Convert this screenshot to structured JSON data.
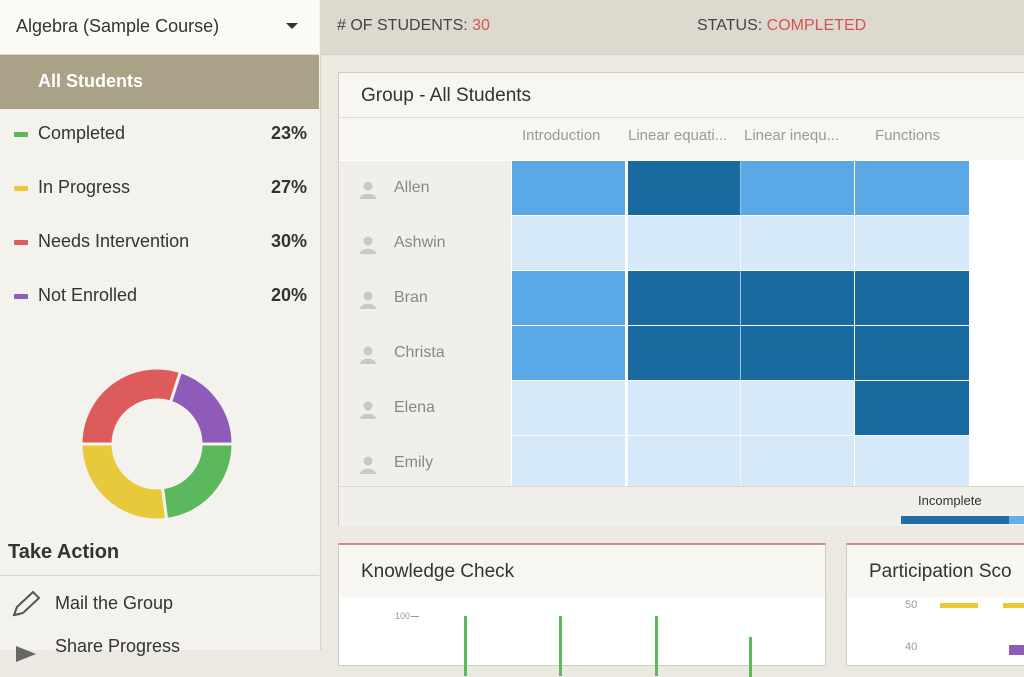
{
  "course_select": {
    "label": "Algebra (Sample Course)"
  },
  "topbar": {
    "students_label": "# OF STUDENTS:",
    "students_value": "30",
    "status_label": "STATUS:",
    "status_value": "COMPLETED"
  },
  "sidebar": {
    "all_students": "All Students",
    "legend": [
      {
        "name": "Completed",
        "pct": "23%",
        "color": "#5cb85c"
      },
      {
        "name": "In Progress",
        "pct": "27%",
        "color": "#e8c93a"
      },
      {
        "name": "Needs Intervention",
        "pct": "30%",
        "color": "#dd5b5b"
      },
      {
        "name": "Not Enrolled",
        "pct": "20%",
        "color": "#8e5bb8"
      }
    ],
    "take_action": "Take Action",
    "actions": [
      {
        "label": "Mail the Group",
        "icon": "pencil-icon"
      },
      {
        "label": "Share Progress",
        "icon": "share-icon"
      }
    ]
  },
  "group": {
    "title": "Group - All Students",
    "columns": [
      "Introduction",
      "Linear equati...",
      "Linear inequ...",
      "Functions"
    ],
    "students": [
      "Allen",
      "Ashwin",
      "Bran",
      "Christa",
      "Elena",
      "Emily"
    ],
    "legend_label": "Incomplete"
  },
  "knowledge_check": {
    "title": "Knowledge Check",
    "tick": "100"
  },
  "participation": {
    "title": "Participation Sco",
    "ticks": [
      "50",
      "40"
    ]
  },
  "chart_data": [
    {
      "type": "pie",
      "labels": [
        "Completed",
        "In Progress",
        "Needs Intervention",
        "Not Enrolled"
      ],
      "values": [
        23,
        27,
        30,
        20
      ],
      "colors": [
        "#5cb85c",
        "#e8c93a",
        "#dd5b5b",
        "#8e5bb8"
      ]
    },
    {
      "type": "heatmap",
      "x": [
        "Introduction",
        "Linear equati...",
        "Linear inequ...",
        "Functions"
      ],
      "y": [
        "Allen",
        "Ashwin",
        "Bran",
        "Christa",
        "Elena",
        "Emily"
      ],
      "levels": [
        [
          2,
          3,
          2,
          2
        ],
        [
          1,
          1,
          1,
          1
        ],
        [
          2,
          3,
          3,
          3
        ],
        [
          2,
          3,
          3,
          3
        ],
        [
          1,
          1,
          1,
          3
        ],
        [
          1,
          1,
          1,
          1
        ]
      ],
      "level_colors": {
        "1": "#d6e9f9",
        "2": "#5aa8e6",
        "3": "#1a6aa2"
      }
    }
  ]
}
